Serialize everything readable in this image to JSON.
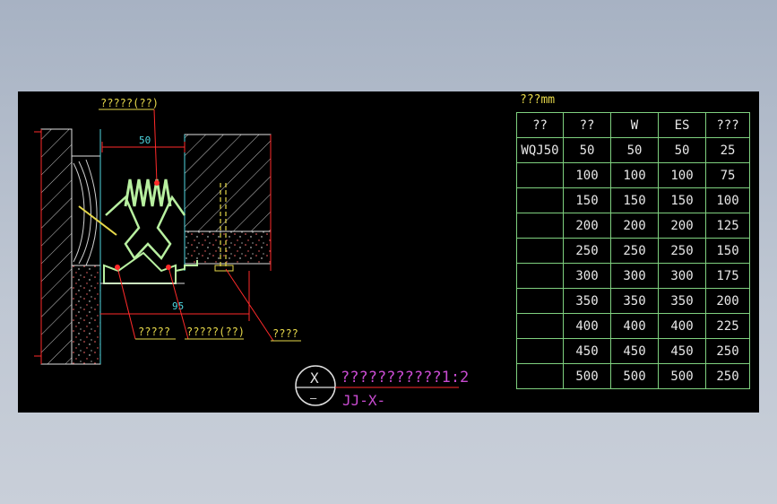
{
  "drawing": {
    "label_top": "?????(??)",
    "dim_top": "50",
    "dim_bottom": "95",
    "label_bottom_left": "?????",
    "label_bottom_mid": "?????(??)",
    "label_bottom_right": "????",
    "symbol_top": "X",
    "symbol_bottom": "—",
    "title_main": "???????????1:2",
    "title_sub": "JJ-X-"
  },
  "table": {
    "title": "???mm",
    "headers": [
      "??",
      "??",
      "W",
      "ES",
      "???"
    ],
    "rows": [
      [
        "WQJ50",
        "50",
        "50",
        "50",
        "25"
      ],
      [
        "",
        "100",
        "100",
        "100",
        "75"
      ],
      [
        "",
        "150",
        "150",
        "150",
        "100"
      ],
      [
        "",
        "200",
        "200",
        "200",
        "125"
      ],
      [
        "",
        "250",
        "250",
        "250",
        "150"
      ],
      [
        "",
        "300",
        "300",
        "300",
        "175"
      ],
      [
        "",
        "350",
        "350",
        "350",
        "200"
      ],
      [
        "",
        "400",
        "400",
        "400",
        "225"
      ],
      [
        "",
        "450",
        "450",
        "450",
        "250"
      ],
      [
        "",
        "500",
        "500",
        "500",
        "250"
      ]
    ]
  },
  "colors": {
    "background": "#000000",
    "table_border": "#7fd07f",
    "label_yellow": "#e6d84a",
    "leader_red": "#ff2a2a",
    "title_magenta": "#c84bd0",
    "dim_cyan": "#4fd6e0",
    "spring_green": "#b8f0a0"
  }
}
